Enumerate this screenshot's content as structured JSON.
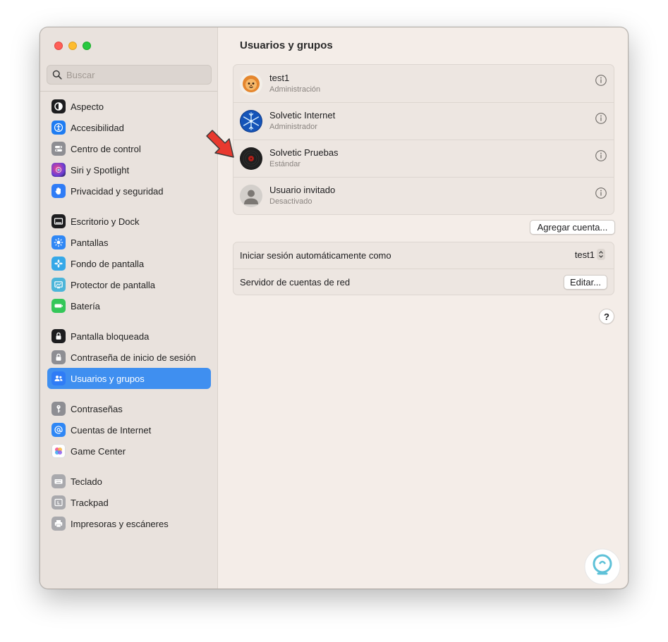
{
  "window": {
    "traffic_lights": [
      "close",
      "minimize",
      "zoom"
    ]
  },
  "search": {
    "placeholder": "Buscar"
  },
  "sidebar": {
    "items": [
      {
        "label": "Aspecto",
        "icon": "appearance-icon",
        "color": "#1d1d1f"
      },
      {
        "label": "Accesibilidad",
        "icon": "accessibility-icon",
        "color": "#1e7cf2"
      },
      {
        "label": "Centro de control",
        "icon": "control-center-icon",
        "color": "#8e8e93"
      },
      {
        "label": "Siri y Spotlight",
        "icon": "siri-icon",
        "color": "#6b3fd6"
      },
      {
        "label": "Privacidad y seguridad",
        "icon": "hand-icon",
        "color": "#2f7cf6"
      },
      {
        "label": "Escritorio y Dock",
        "icon": "dock-icon",
        "color": "#1d1d1f"
      },
      {
        "label": "Pantallas",
        "icon": "display-icon",
        "color": "#2f87f5"
      },
      {
        "label": "Fondo de pantalla",
        "icon": "wallpaper-icon",
        "color": "#35a8e8"
      },
      {
        "label": "Protector de pantalla",
        "icon": "screensaver-icon",
        "color": "#4cb5d9"
      },
      {
        "label": "Batería",
        "icon": "battery-icon",
        "color": "#34c759"
      },
      {
        "label": "Pantalla bloqueada",
        "icon": "lock-screen-icon",
        "color": "#1d1d1f"
      },
      {
        "label": "Contraseña de inicio de sesión",
        "icon": "lock-icon",
        "color": "#8e8e93"
      },
      {
        "label": "Usuarios y grupos",
        "icon": "users-icon",
        "color": "#2f7cf6",
        "selected": true
      },
      {
        "label": "Contraseñas",
        "icon": "key-icon",
        "color": "#8e8e93"
      },
      {
        "label": "Cuentas de Internet",
        "icon": "at-icon",
        "color": "#2f87f5"
      },
      {
        "label": "Game Center",
        "icon": "game-center-icon",
        "color": "#ffffff"
      },
      {
        "label": "Teclado",
        "icon": "keyboard-icon",
        "color": "#8e8e93"
      },
      {
        "label": "Trackpad",
        "icon": "trackpad-icon",
        "color": "#8e8e93"
      },
      {
        "label": "Impresoras y escáneres",
        "icon": "printer-icon",
        "color": "#8e8e93"
      }
    ]
  },
  "main": {
    "title": "Usuarios y grupos",
    "users": [
      {
        "name": "test1",
        "role": "Administración",
        "avatar": "lion-avatar"
      },
      {
        "name": "Solvetic Internet",
        "role": "Administrador",
        "avatar": "snowflake-avatar"
      },
      {
        "name": "Solvetic Pruebas",
        "role": "Estándar",
        "avatar": "vinyl-avatar"
      },
      {
        "name": "Usuario invitado",
        "role": "Desactivado",
        "avatar": "guest-avatar"
      }
    ],
    "add_account_label": "Agregar cuenta...",
    "settings": {
      "autologin_label": "Iniciar sesión automáticamente como",
      "autologin_value": "test1",
      "network_server_label": "Servidor de cuentas de red",
      "edit_label": "Editar..."
    },
    "help_label": "?"
  },
  "colors": {
    "accent": "#3f8ff0",
    "arrow": "#e8392f"
  }
}
